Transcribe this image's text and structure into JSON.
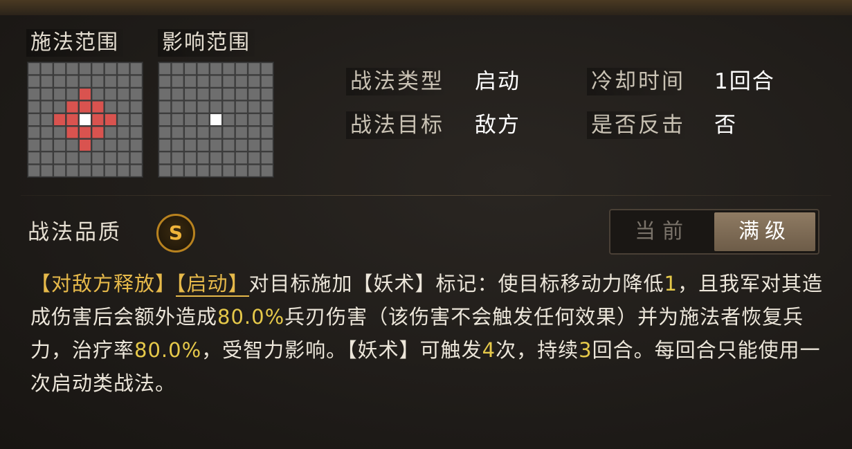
{
  "range": {
    "cast_title": "施法范围",
    "effect_title": "影响范围"
  },
  "info": {
    "type_label": "战法类型",
    "type_value": "启动",
    "cooldown_label": "冷却时间",
    "cooldown_value": "1回合",
    "target_label": "战法目标",
    "target_value": "敌方",
    "counter_label": "是否反击",
    "counter_value": "否"
  },
  "quality": {
    "label": "战法品质",
    "grade": "S"
  },
  "level_toggle": {
    "current": "当前",
    "max": "满级",
    "selected": "满级"
  },
  "description": {
    "tag1": "【对敌方释放】",
    "tag2": "【启动】",
    "t1": "对目标施加【妖术】标记：使目标移动力降低",
    "n1": "1",
    "t2": "，且我军对其造成伤害后会额外造成",
    "n2": "80.0%",
    "t3": "兵刃伤害（该伤害不会触发任何效果）并为施法者恢复兵力，治疗率",
    "n3": "80.0%",
    "t4": "，受智力影响。【妖术】可触发",
    "n4": "4",
    "t5": "次，持续",
    "n5": "3",
    "t6": "回合。每回合只能使用一次启动类战法。"
  },
  "colors": {
    "highlight": "#e6b94a",
    "range_cell": "#d9534f",
    "center_cell": "#ffffff",
    "grid_cell": "#6e6e6e"
  }
}
